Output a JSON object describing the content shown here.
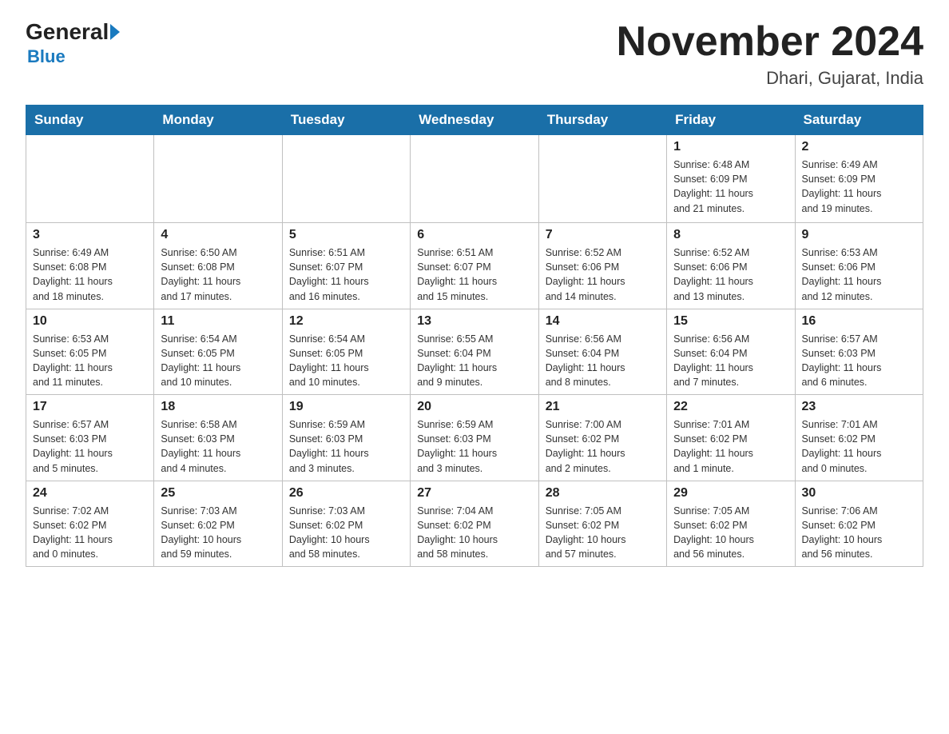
{
  "logo": {
    "general": "General",
    "blue": "Blue"
  },
  "header": {
    "month_year": "November 2024",
    "location": "Dhari, Gujarat, India"
  },
  "weekdays": [
    "Sunday",
    "Monday",
    "Tuesday",
    "Wednesday",
    "Thursday",
    "Friday",
    "Saturday"
  ],
  "weeks": [
    [
      {
        "day": "",
        "info": ""
      },
      {
        "day": "",
        "info": ""
      },
      {
        "day": "",
        "info": ""
      },
      {
        "day": "",
        "info": ""
      },
      {
        "day": "",
        "info": ""
      },
      {
        "day": "1",
        "info": "Sunrise: 6:48 AM\nSunset: 6:09 PM\nDaylight: 11 hours\nand 21 minutes."
      },
      {
        "day": "2",
        "info": "Sunrise: 6:49 AM\nSunset: 6:09 PM\nDaylight: 11 hours\nand 19 minutes."
      }
    ],
    [
      {
        "day": "3",
        "info": "Sunrise: 6:49 AM\nSunset: 6:08 PM\nDaylight: 11 hours\nand 18 minutes."
      },
      {
        "day": "4",
        "info": "Sunrise: 6:50 AM\nSunset: 6:08 PM\nDaylight: 11 hours\nand 17 minutes."
      },
      {
        "day": "5",
        "info": "Sunrise: 6:51 AM\nSunset: 6:07 PM\nDaylight: 11 hours\nand 16 minutes."
      },
      {
        "day": "6",
        "info": "Sunrise: 6:51 AM\nSunset: 6:07 PM\nDaylight: 11 hours\nand 15 minutes."
      },
      {
        "day": "7",
        "info": "Sunrise: 6:52 AM\nSunset: 6:06 PM\nDaylight: 11 hours\nand 14 minutes."
      },
      {
        "day": "8",
        "info": "Sunrise: 6:52 AM\nSunset: 6:06 PM\nDaylight: 11 hours\nand 13 minutes."
      },
      {
        "day": "9",
        "info": "Sunrise: 6:53 AM\nSunset: 6:06 PM\nDaylight: 11 hours\nand 12 minutes."
      }
    ],
    [
      {
        "day": "10",
        "info": "Sunrise: 6:53 AM\nSunset: 6:05 PM\nDaylight: 11 hours\nand 11 minutes."
      },
      {
        "day": "11",
        "info": "Sunrise: 6:54 AM\nSunset: 6:05 PM\nDaylight: 11 hours\nand 10 minutes."
      },
      {
        "day": "12",
        "info": "Sunrise: 6:54 AM\nSunset: 6:05 PM\nDaylight: 11 hours\nand 10 minutes."
      },
      {
        "day": "13",
        "info": "Sunrise: 6:55 AM\nSunset: 6:04 PM\nDaylight: 11 hours\nand 9 minutes."
      },
      {
        "day": "14",
        "info": "Sunrise: 6:56 AM\nSunset: 6:04 PM\nDaylight: 11 hours\nand 8 minutes."
      },
      {
        "day": "15",
        "info": "Sunrise: 6:56 AM\nSunset: 6:04 PM\nDaylight: 11 hours\nand 7 minutes."
      },
      {
        "day": "16",
        "info": "Sunrise: 6:57 AM\nSunset: 6:03 PM\nDaylight: 11 hours\nand 6 minutes."
      }
    ],
    [
      {
        "day": "17",
        "info": "Sunrise: 6:57 AM\nSunset: 6:03 PM\nDaylight: 11 hours\nand 5 minutes."
      },
      {
        "day": "18",
        "info": "Sunrise: 6:58 AM\nSunset: 6:03 PM\nDaylight: 11 hours\nand 4 minutes."
      },
      {
        "day": "19",
        "info": "Sunrise: 6:59 AM\nSunset: 6:03 PM\nDaylight: 11 hours\nand 3 minutes."
      },
      {
        "day": "20",
        "info": "Sunrise: 6:59 AM\nSunset: 6:03 PM\nDaylight: 11 hours\nand 3 minutes."
      },
      {
        "day": "21",
        "info": "Sunrise: 7:00 AM\nSunset: 6:02 PM\nDaylight: 11 hours\nand 2 minutes."
      },
      {
        "day": "22",
        "info": "Sunrise: 7:01 AM\nSunset: 6:02 PM\nDaylight: 11 hours\nand 1 minute."
      },
      {
        "day": "23",
        "info": "Sunrise: 7:01 AM\nSunset: 6:02 PM\nDaylight: 11 hours\nand 0 minutes."
      }
    ],
    [
      {
        "day": "24",
        "info": "Sunrise: 7:02 AM\nSunset: 6:02 PM\nDaylight: 11 hours\nand 0 minutes."
      },
      {
        "day": "25",
        "info": "Sunrise: 7:03 AM\nSunset: 6:02 PM\nDaylight: 10 hours\nand 59 minutes."
      },
      {
        "day": "26",
        "info": "Sunrise: 7:03 AM\nSunset: 6:02 PM\nDaylight: 10 hours\nand 58 minutes."
      },
      {
        "day": "27",
        "info": "Sunrise: 7:04 AM\nSunset: 6:02 PM\nDaylight: 10 hours\nand 58 minutes."
      },
      {
        "day": "28",
        "info": "Sunrise: 7:05 AM\nSunset: 6:02 PM\nDaylight: 10 hours\nand 57 minutes."
      },
      {
        "day": "29",
        "info": "Sunrise: 7:05 AM\nSunset: 6:02 PM\nDaylight: 10 hours\nand 56 minutes."
      },
      {
        "day": "30",
        "info": "Sunrise: 7:06 AM\nSunset: 6:02 PM\nDaylight: 10 hours\nand 56 minutes."
      }
    ]
  ]
}
